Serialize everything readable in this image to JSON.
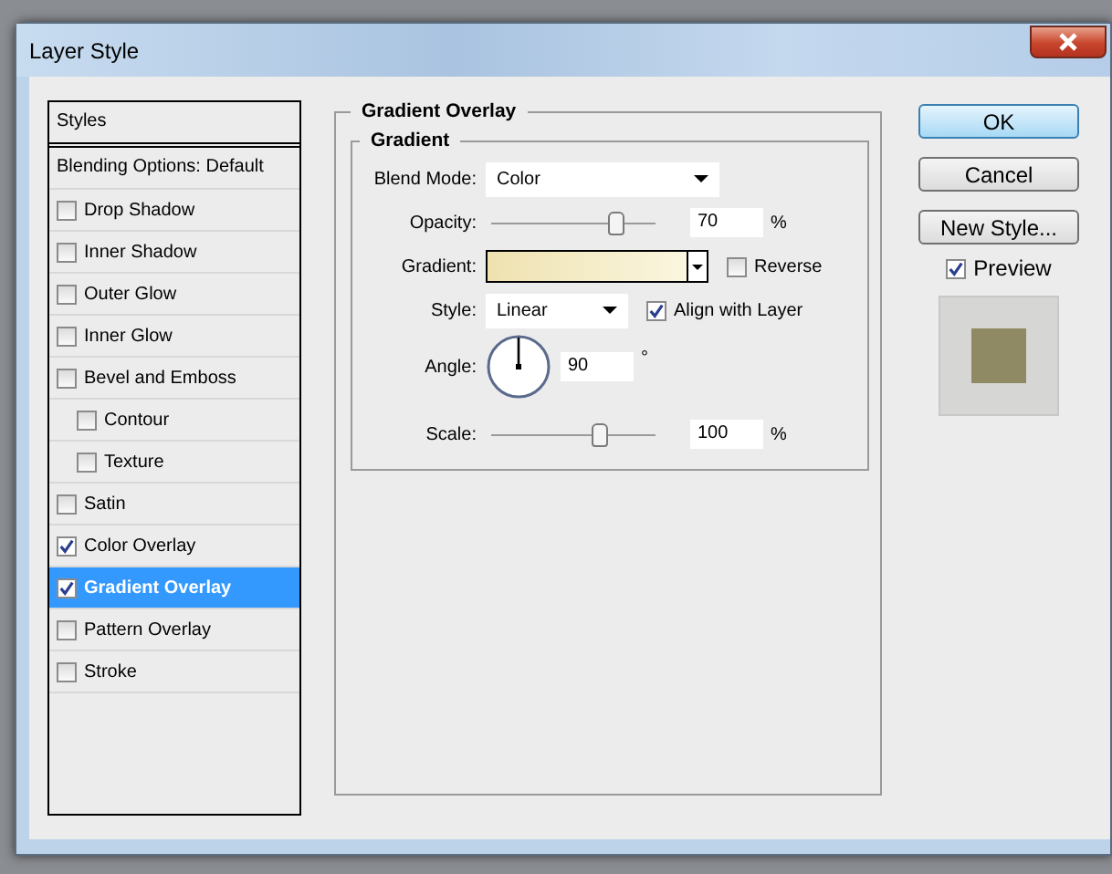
{
  "window": {
    "title": "Layer Style"
  },
  "sidebar": {
    "header": "Styles",
    "blending_options": "Blending Options: Default",
    "items": [
      {
        "label": "Drop Shadow",
        "checked": false,
        "selected": false
      },
      {
        "label": "Inner Shadow",
        "checked": false,
        "selected": false
      },
      {
        "label": "Outer Glow",
        "checked": false,
        "selected": false
      },
      {
        "label": "Inner Glow",
        "checked": false,
        "selected": false
      },
      {
        "label": "Bevel and Emboss",
        "checked": false,
        "selected": false,
        "children": [
          {
            "label": "Contour",
            "checked": false,
            "selected": false
          },
          {
            "label": "Texture",
            "checked": false,
            "selected": false
          }
        ]
      },
      {
        "label": "Satin",
        "checked": false,
        "selected": false
      },
      {
        "label": "Color Overlay",
        "checked": true,
        "selected": false
      },
      {
        "label": "Gradient Overlay",
        "checked": true,
        "selected": true
      },
      {
        "label": "Pattern Overlay",
        "checked": false,
        "selected": false
      },
      {
        "label": "Stroke",
        "checked": false,
        "selected": false
      }
    ]
  },
  "section": {
    "title": "Gradient Overlay",
    "group": "Gradient",
    "blend_mode": {
      "label": "Blend Mode:",
      "value": "Color"
    },
    "opacity": {
      "label": "Opacity:",
      "level": 0.76,
      "value": "70",
      "unit": "%"
    },
    "gradient": {
      "label": "Gradient:"
    },
    "reverse": {
      "label": "Reverse",
      "checked": false
    },
    "style": {
      "label": "Style:",
      "value": "Linear"
    },
    "align": {
      "label": "Align with Layer",
      "checked": true
    },
    "angle": {
      "label": "Angle:",
      "value": "90",
      "unit": "°"
    },
    "scale": {
      "label": "Scale:",
      "level": 0.66,
      "value": "100",
      "unit": "%"
    }
  },
  "buttons": [
    {
      "label": "OK",
      "default": true
    },
    {
      "label": "Cancel",
      "default": false
    },
    {
      "label": "New Style...",
      "default": false
    }
  ],
  "preview": {
    "label": "Preview",
    "checked": true
  }
}
